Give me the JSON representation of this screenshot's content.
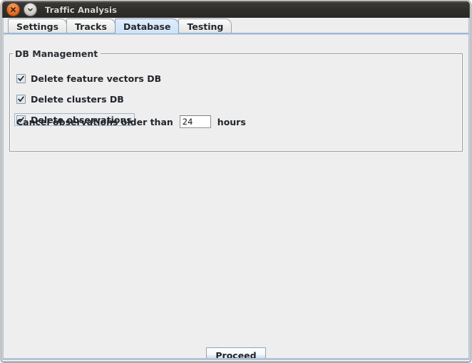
{
  "window": {
    "title": "Traffic Analysis",
    "close_icon": "close-circle-icon",
    "minimize_icon": "chevron-down-circle-icon"
  },
  "tabs": [
    {
      "label": "Settings",
      "selected": false
    },
    {
      "label": "Tracks",
      "selected": false
    },
    {
      "label": "Database",
      "selected": true
    },
    {
      "label": "Testing",
      "selected": false
    }
  ],
  "groupbox": {
    "legend": "DB Management",
    "checkboxes": [
      {
        "label": "Delete feature vectors DB",
        "checked": true,
        "focused": false
      },
      {
        "label": "Delete clusters DB",
        "checked": true,
        "focused": false
      },
      {
        "label": "Delete observations",
        "checked": true,
        "focused": true
      }
    ],
    "cancel_row": {
      "label": "Cancel observations older than",
      "value": "24",
      "placeholder": "",
      "suffix": "hours"
    }
  },
  "footer": {
    "proceed_label": "Proceed"
  },
  "colors": {
    "titlebar": "#302e2b",
    "close_button": "#e8742a",
    "selected_tab": "#d3e6fa",
    "window_border": "#b4c4d8",
    "panel_background": "#eeeeee"
  }
}
